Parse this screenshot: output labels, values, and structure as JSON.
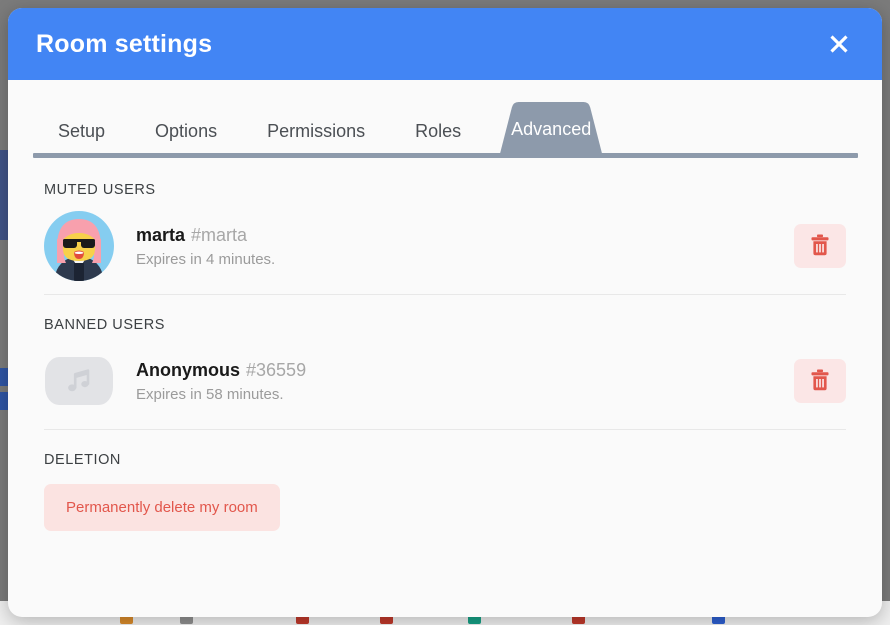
{
  "modal": {
    "title": "Room settings",
    "close_icon": "close-icon",
    "accent_color": "#4285f4",
    "surface_color": "#fafafa"
  },
  "tabs": {
    "active": "Advanced",
    "active_tab_color": "#8d9aab",
    "items": [
      {
        "label": "Setup",
        "active": false
      },
      {
        "label": "Options",
        "active": false
      },
      {
        "label": "Permissions",
        "active": false
      },
      {
        "label": "Roles",
        "active": false
      },
      {
        "label": "Advanced",
        "active": true
      }
    ]
  },
  "sections": {
    "muted": {
      "title": "MUTED USERS",
      "users": [
        {
          "name": "marta",
          "tag": "#marta",
          "expiry": "Expires in 4 minutes.",
          "avatar_type": "illustration",
          "avatar_name": "avatar-marta",
          "delete_label": "trash-icon"
        }
      ]
    },
    "banned": {
      "title": "BANNED USERS",
      "users": [
        {
          "name": "Anonymous",
          "tag": "#36559",
          "expiry": "Expires in 58 minutes.",
          "avatar_type": "music-placeholder",
          "avatar_name": "avatar-anonymous",
          "delete_label": "trash-icon"
        }
      ]
    },
    "deletion": {
      "title": "DELETION",
      "delete_room_label": "Permanently delete my room",
      "danger_color": "#e2574c",
      "danger_bg_color": "#fbe3e1"
    }
  }
}
